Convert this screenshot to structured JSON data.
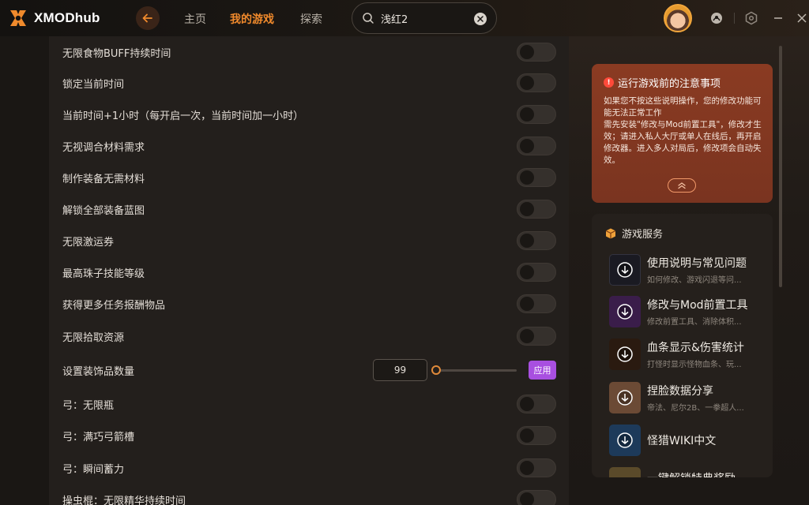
{
  "app": {
    "name": "XMODhub"
  },
  "nav": {
    "items": [
      {
        "label": "主页"
      },
      {
        "label": "我的游戏"
      },
      {
        "label": "探索"
      }
    ]
  },
  "search": {
    "value": "浅红2"
  },
  "colors": {
    "accent": "#f08a2c",
    "apply": "#a84fe0",
    "notice_bg": "#8a3b22"
  },
  "mods": [
    {
      "label": "无限食物BUFF持续时间",
      "type": "toggle",
      "on": false
    },
    {
      "label": "锁定当前时间",
      "type": "toggle",
      "on": false
    },
    {
      "label": "当前时间+1小时（每开启一次，当前时间加一小时）",
      "type": "toggle",
      "on": false
    },
    {
      "label": "无视调合材料需求",
      "type": "toggle",
      "on": false
    },
    {
      "label": "制作装备无需材料",
      "type": "toggle",
      "on": false
    },
    {
      "label": "解锁全部装备蓝图",
      "type": "toggle",
      "on": false
    },
    {
      "label": "无限激运券",
      "type": "toggle",
      "on": false
    },
    {
      "label": "最高珠子技能等级",
      "type": "toggle",
      "on": false
    },
    {
      "label": "获得更多任务报酬物品",
      "type": "toggle",
      "on": false
    },
    {
      "label": "无限拾取资源",
      "type": "toggle",
      "on": false
    },
    {
      "label": "设置装饰品数量",
      "type": "slider",
      "value": "99",
      "slider_fraction": 0,
      "apply_label": "应用"
    },
    {
      "label": "弓：无限瓶",
      "type": "toggle",
      "on": false
    },
    {
      "label": "弓：满巧弓箭槽",
      "type": "toggle",
      "on": false
    },
    {
      "label": "弓：瞬间蓄力",
      "type": "toggle",
      "on": false
    },
    {
      "label": "操虫棍：无限精华持续时间",
      "type": "toggle",
      "on": false
    }
  ],
  "notice": {
    "title": "运行游戏前的注意事项",
    "body_1": "如果您不按这些说明操作，您的修改功能可能无法正常工作",
    "body_2": "需先安装\"修改与Mod前置工具\"，修改才生效；请进入私人大厅或单人在线后，再开启修改器。进入多人对局后，修改项会自动失效。"
  },
  "services": {
    "title": "游戏服务",
    "items": [
      {
        "title": "使用说明与常见问题",
        "subtitle": "如何修改、游戏闪退等问..."
      },
      {
        "title": "修改与Mod前置工具",
        "subtitle": "修改前置工具、消除体积..."
      },
      {
        "title": "血条显示&伤害统计",
        "subtitle": "打怪时显示怪物血条、玩..."
      },
      {
        "title": "捏脸数据分享",
        "subtitle": "帝法、尼尔2B、一拳超人..."
      },
      {
        "title": "怪猎WIKI中文",
        "subtitle": ""
      },
      {
        "title": "一键解锁特典奖励",
        "subtitle": ""
      }
    ]
  }
}
